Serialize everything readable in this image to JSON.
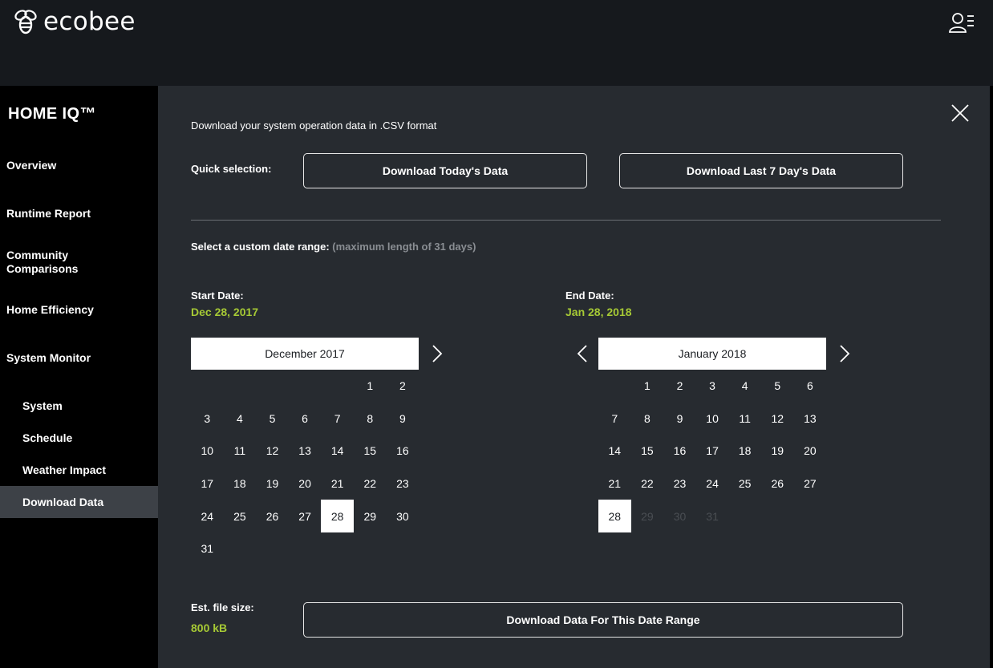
{
  "brand": {
    "name": "ecobee"
  },
  "sidebar": {
    "title": "HOME IQ™",
    "items": [
      "Overview",
      "Runtime Report",
      "Community Comparisons",
      "Home Efficiency",
      "System Monitor"
    ],
    "subitems": [
      "System",
      "Schedule",
      "Weather Impact",
      "Download Data"
    ],
    "active": "Download Data"
  },
  "panel": {
    "intro": "Download your system operation data in .CSV format",
    "quick_label": "Quick selection:",
    "btn_today": "Download Today's Data",
    "btn_week": "Download Last 7 Day's Data",
    "range_label": "Select a custom date range:",
    "range_hint": "(maximum length of 31 days)",
    "start_label": "Start Date:",
    "start_value": "Dec 28, 2017",
    "end_label": "End Date:",
    "end_value": "Jan 28, 2018",
    "size_label": "Est. file size:",
    "size_value": "800 kB",
    "btn_range": "Download Data For This Date Range"
  },
  "calendars": {
    "start": {
      "month": "December 2017",
      "offset": 5,
      "days": 31,
      "selected": 28,
      "disabled_from": 32
    },
    "end": {
      "month": "January 2018",
      "offset": 1,
      "days": 31,
      "selected": 28,
      "disabled_from": 29
    }
  },
  "colors": {
    "accent": "#a6c935",
    "panel": "#272b30",
    "topbar": "#16191d"
  }
}
